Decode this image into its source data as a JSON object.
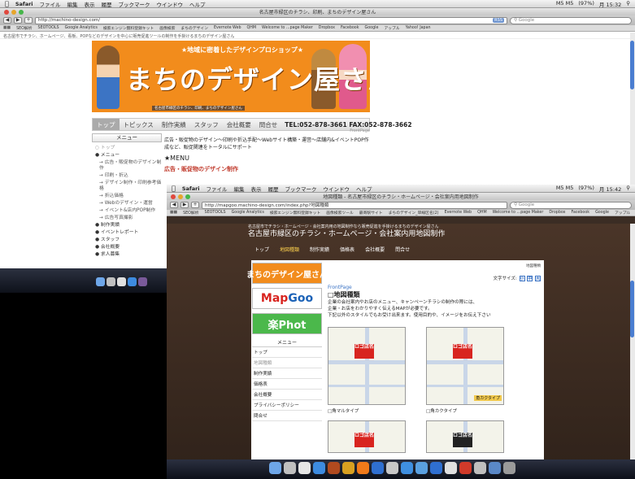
{
  "w1": {
    "menubar": {
      "app": "Safari",
      "items": [
        "ファイル",
        "編集",
        "表示",
        "履歴",
        "ブックマーク",
        "ウインドウ",
        "ヘルプ"
      ],
      "status": "M5 M5",
      "battery": "(97%)",
      "clock": "月 15:32"
    },
    "title": "名古屋市緑区のチラシ、印刷、まちのデザイン屋さん",
    "url": "http://machino-design.com/",
    "rss": "RSS",
    "search_placeholder": "Google",
    "bookmarks": [
      "SEO解析",
      "SEOTOOLS",
      "Google Analytics",
      "検索エンジン無料登録キット",
      "画像検索",
      "まちのデザイン",
      "Evernote Web",
      "QHM",
      "Welcome to …page Maker",
      "Dropbox",
      "Facebook",
      "Google",
      "アップル",
      "Yahoo! Japan"
    ],
    "statusline": "名古屋市でチラシ、ホームページ、看板、POPなどのデザインを中心に販売促進ツールの制作を手掛けるまちのデザイン屋さん",
    "banner": {
      "tag": "★地域に密着したデザインプロショップ★",
      "title": "まちのデザイン屋さん",
      "sub": "名古屋市緑区のチラシ、印刷、まちのデザイン屋さん"
    },
    "nav": [
      "トップ",
      "トピックス",
      "制作実績",
      "スタッフ",
      "会社概要",
      "問合せ"
    ],
    "tel": "TEL:052-878-3661 FAX:052-878-3662",
    "menu_head": "メニュー",
    "side": [
      {
        "label": "トップ",
        "type": "top"
      },
      {
        "label": "メニュー",
        "type": "main"
      },
      {
        "label": "広告・販促物のデザイン制作",
        "type": "sub"
      },
      {
        "label": "印刷・折込",
        "type": "sub"
      },
      {
        "label": "デザイン制作・印刷参考価格",
        "type": "sub"
      },
      {
        "label": "折込価格",
        "type": "sub"
      },
      {
        "label": "Webのデザイン・運営",
        "type": "sub"
      },
      {
        "label": "イベント&店内POP制作",
        "type": "sub"
      },
      {
        "label": "広告写真撮影",
        "type": "sub"
      },
      {
        "label": "制作実績",
        "type": "main"
      },
      {
        "label": "イベントレポート",
        "type": "main"
      },
      {
        "label": "スタッフ",
        "type": "main"
      },
      {
        "label": "会社概要",
        "type": "main"
      },
      {
        "label": "求人募集",
        "type": "main"
      }
    ],
    "frontpage": "FrontPage",
    "intro": "広告・販促物のデザイン〜印刷や折込手配〜Webサイト構築・運営〜店舗内&イベントPOP作成など、販促関連をトータルにサポート",
    "menu_title": "★MENU",
    "link": "広告・販促物のデザイン制作"
  },
  "w2": {
    "menubar": {
      "app": "Safari",
      "items": [
        "ファイル",
        "編集",
        "表示",
        "履歴",
        "ブックマーク",
        "ウインドウ",
        "ヘルプ"
      ],
      "status": "M5 M5",
      "battery": "(97%)",
      "clock": "月 15:42"
    },
    "title": "地図種類 - 名古屋市緑区のチラシ・ホームページ・会社案内用地図制作",
    "url": "http://mapgoo.machino-design.com/index.php?地図種類",
    "search_placeholder": "Google",
    "bookmarks": [
      "SEO解析",
      "SEOTOOLS",
      "Google Analytics",
      "検索エンジン無料登録キット",
      "画像検索ツール",
      "最寄駅サイト",
      "まちのデザイン_単線区名(2)",
      "Evernote Web",
      "QHM",
      "Welcome to …page Maker",
      "Dropbox",
      "Facebook",
      "Google",
      "アップル",
      "Yahoo! Japan"
    ],
    "topnote": "名古屋市でチラシ・ホームページ・会社案内用の地図制作なら販売促進を手掛けるまちのデザイン屋さん",
    "site_title": "名古屋市緑区のチラシ・ホームページ・会社案内用地図制作",
    "nav": [
      "トップ",
      "地図種類",
      "制作実績",
      "価格表",
      "会社概要",
      "問合せ"
    ],
    "logos": {
      "machi": "まちのデザイン屋さん",
      "map_a": "Map",
      "map_b": "Goo",
      "raku": "楽Phot"
    },
    "menu_head": "メニュー",
    "side": [
      "トップ",
      "地図種類",
      "制作実績",
      "価格表",
      "会社概要",
      "プライバシーポリシー",
      "問合せ"
    ],
    "page_path": "地図種類",
    "fontsize_label": "文字サイズ:",
    "fontsize_btns": [
      "小",
      "中",
      "大"
    ],
    "frontpage": "FrontPage",
    "heading": "□地図種類",
    "desc": [
      "企業の会社案内やお店のメニュー、キャンペーンチラシの制作の際には、",
      "企業・お店をわかりやすく伝えるMAPが必要です。",
      "下記以外のスタイルでもお受け出来ます。使用目的や、イメージをお伝え下さい"
    ],
    "maps": [
      {
        "badge": "ロゴ店名",
        "label": "□角マルタイプ"
      },
      {
        "badge": "ロゴ店名",
        "label": "□角カクタイプ",
        "extra": "角カクタイプ"
      }
    ],
    "maps_row2": [
      {
        "badge": "ロゴ店名"
      },
      {
        "badge": "ロゴ店名"
      }
    ]
  }
}
